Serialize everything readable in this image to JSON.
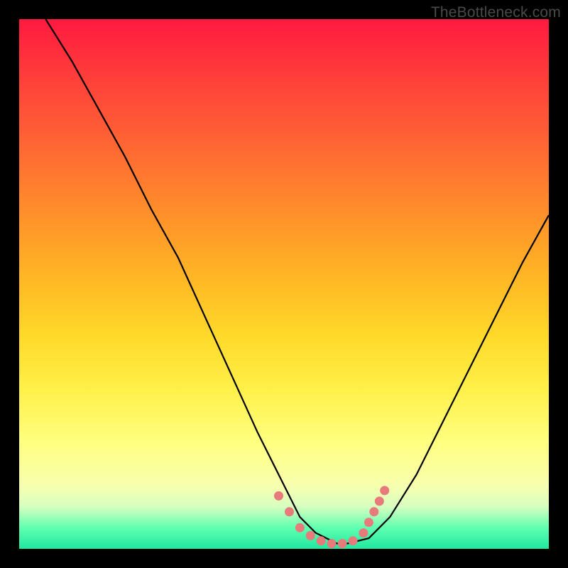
{
  "watermark": "TheBottleneck.com",
  "chart_data": {
    "type": "line",
    "title": "",
    "xlabel": "",
    "ylabel": "",
    "xlim": [
      0,
      100
    ],
    "ylim": [
      0,
      100
    ],
    "series": [
      {
        "name": "bottleneck-curve",
        "x": [
          5,
          10,
          15,
          20,
          25,
          30,
          35,
          40,
          45,
          50,
          53,
          56,
          60,
          62,
          66,
          70,
          75,
          80,
          85,
          90,
          95,
          100
        ],
        "values": [
          100,
          92,
          83,
          74,
          64,
          55,
          44,
          33,
          22,
          12,
          6,
          3,
          1,
          1,
          2,
          6,
          14,
          24,
          34,
          44,
          54,
          63
        ]
      }
    ],
    "markers": {
      "name": "curve-dots",
      "color": "#e77a7a",
      "points": [
        {
          "x": 49,
          "y": 10
        },
        {
          "x": 51,
          "y": 7
        },
        {
          "x": 53,
          "y": 4
        },
        {
          "x": 55,
          "y": 2.5
        },
        {
          "x": 57,
          "y": 1.5
        },
        {
          "x": 59,
          "y": 1
        },
        {
          "x": 61,
          "y": 1
        },
        {
          "x": 63,
          "y": 1.5
        },
        {
          "x": 65,
          "y": 3
        },
        {
          "x": 66,
          "y": 5
        },
        {
          "x": 67,
          "y": 7
        },
        {
          "x": 68,
          "y": 9
        },
        {
          "x": 69,
          "y": 11
        }
      ]
    }
  }
}
